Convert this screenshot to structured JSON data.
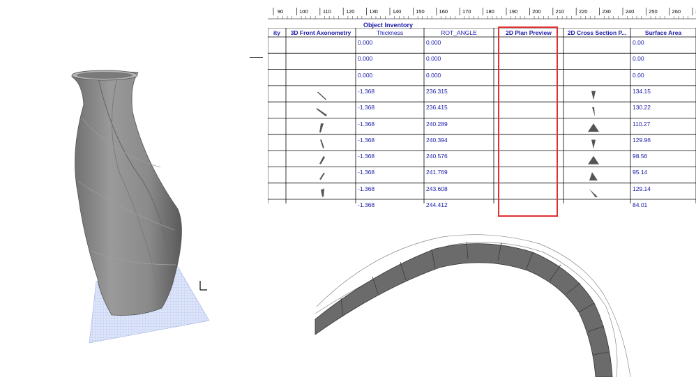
{
  "ruler": {
    "ticks": [
      "90",
      "100",
      "110",
      "120",
      "130",
      "140",
      "150",
      "160",
      "170",
      "180",
      "190",
      "200",
      "210",
      "220",
      "230",
      "240",
      "250",
      "260",
      "270"
    ]
  },
  "inventory": {
    "title": "Object Inventory",
    "columns": [
      {
        "key": "qty",
        "label": "ity",
        "bold": true
      },
      {
        "key": "axo",
        "label": "3D Front Axonometry",
        "bold": true
      },
      {
        "key": "thickness",
        "label": "Thickness",
        "bold": false
      },
      {
        "key": "rot",
        "label": "ROT_ANGLE",
        "bold": false
      },
      {
        "key": "plan",
        "label": "2D Plan Preview",
        "bold": true
      },
      {
        "key": "section",
        "label": "2D Cross Section P...",
        "bold": true
      },
      {
        "key": "area",
        "label": "Surface Area",
        "bold": true
      }
    ],
    "rows": [
      {
        "thickness": "0.000",
        "rot": "0.000",
        "area": "0.00",
        "axo": null,
        "section": null
      },
      {
        "thickness": "0.000",
        "rot": "0.000",
        "area": "0.00",
        "axo": null,
        "section": null
      },
      {
        "thickness": "0.000",
        "rot": "0.000",
        "area": "0.00",
        "axo": null,
        "section": null
      },
      {
        "thickness": "-1.368",
        "rot": "236.315",
        "area": "134.15",
        "axo": "sliver-a",
        "section": "wedge-narrow"
      },
      {
        "thickness": "-1.368",
        "rot": "236.415",
        "area": "130.22",
        "axo": "sliver-b",
        "section": "wedge-thin"
      },
      {
        "thickness": "-1.368",
        "rot": "240.289",
        "area": "110.27",
        "axo": "sliver-c",
        "section": "triangle-wide"
      },
      {
        "thickness": "-1.368",
        "rot": "240.394",
        "area": "129.96",
        "axo": "sliver-d",
        "section": "wedge-narrow"
      },
      {
        "thickness": "-1.368",
        "rot": "240.576",
        "area": "98.56",
        "axo": "sliver-e",
        "section": "triangle-wide"
      },
      {
        "thickness": "-1.368",
        "rot": "241.769",
        "area": "95.14",
        "axo": "sliver-f",
        "section": "triangle-mid"
      },
      {
        "thickness": "-1.368",
        "rot": "243.608",
        "area": "129.14",
        "axo": "sliver-g",
        "section": "wedge-long"
      },
      {
        "thickness": "-1.368",
        "rot": "244.412",
        "area": "84.01",
        "axo": "sliver-h",
        "section": "triangle-small"
      }
    ]
  },
  "colors": {
    "schedule_text": "#1a1aa8",
    "highlight": "#e03030",
    "vase_fill": "#8f8f8f",
    "plan_band": "#6b6b6b",
    "grid_base": "#c9d6f5"
  }
}
